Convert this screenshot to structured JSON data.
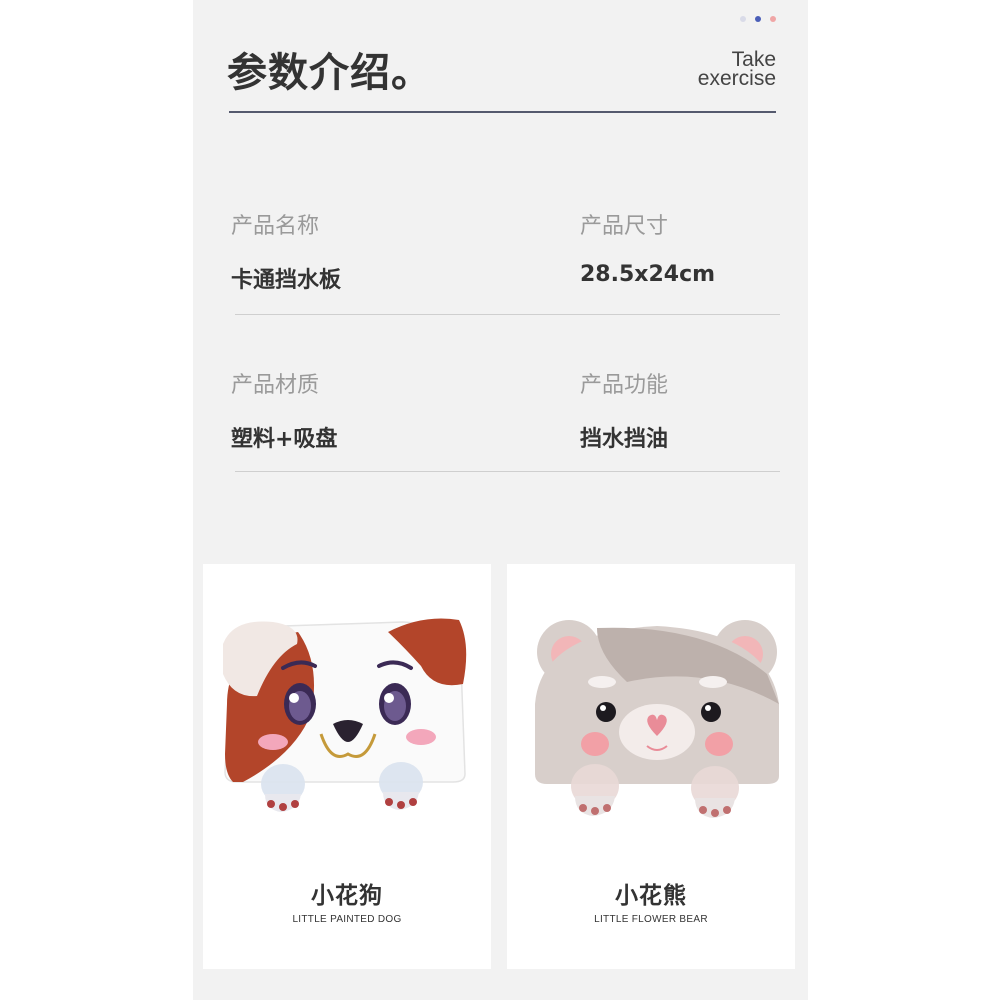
{
  "header": {
    "title": "参数介绍。",
    "en_title_line1": "Take",
    "en_title_line2": "exercise"
  },
  "carousel_dots": [
    {
      "color": "#d9dbe8"
    },
    {
      "color": "#4a5eb8"
    },
    {
      "color": "#f0a6a6"
    }
  ],
  "params": {
    "name": {
      "label": "产品名称",
      "value": "卡通挡水板"
    },
    "size": {
      "label": "产品尺寸",
      "value": "28.5x24cm"
    },
    "material": {
      "label": "产品材质",
      "value": "塑料+吸盘"
    },
    "function": {
      "label": "产品功能",
      "value": "挡水挡油"
    }
  },
  "products": [
    {
      "cn_name": "小花狗",
      "en_name": "LITTLE PAINTED DOG",
      "image": "dog-splash-guard-image"
    },
    {
      "cn_name": "小花熊",
      "en_name": "LITTLE FLOWER BEAR",
      "image": "bear-splash-guard-image"
    }
  ],
  "colors": {
    "page_background": "#f2f2f2",
    "title_text": "#333333",
    "label_text": "#9a9a9a",
    "rule": "#555a6e"
  }
}
